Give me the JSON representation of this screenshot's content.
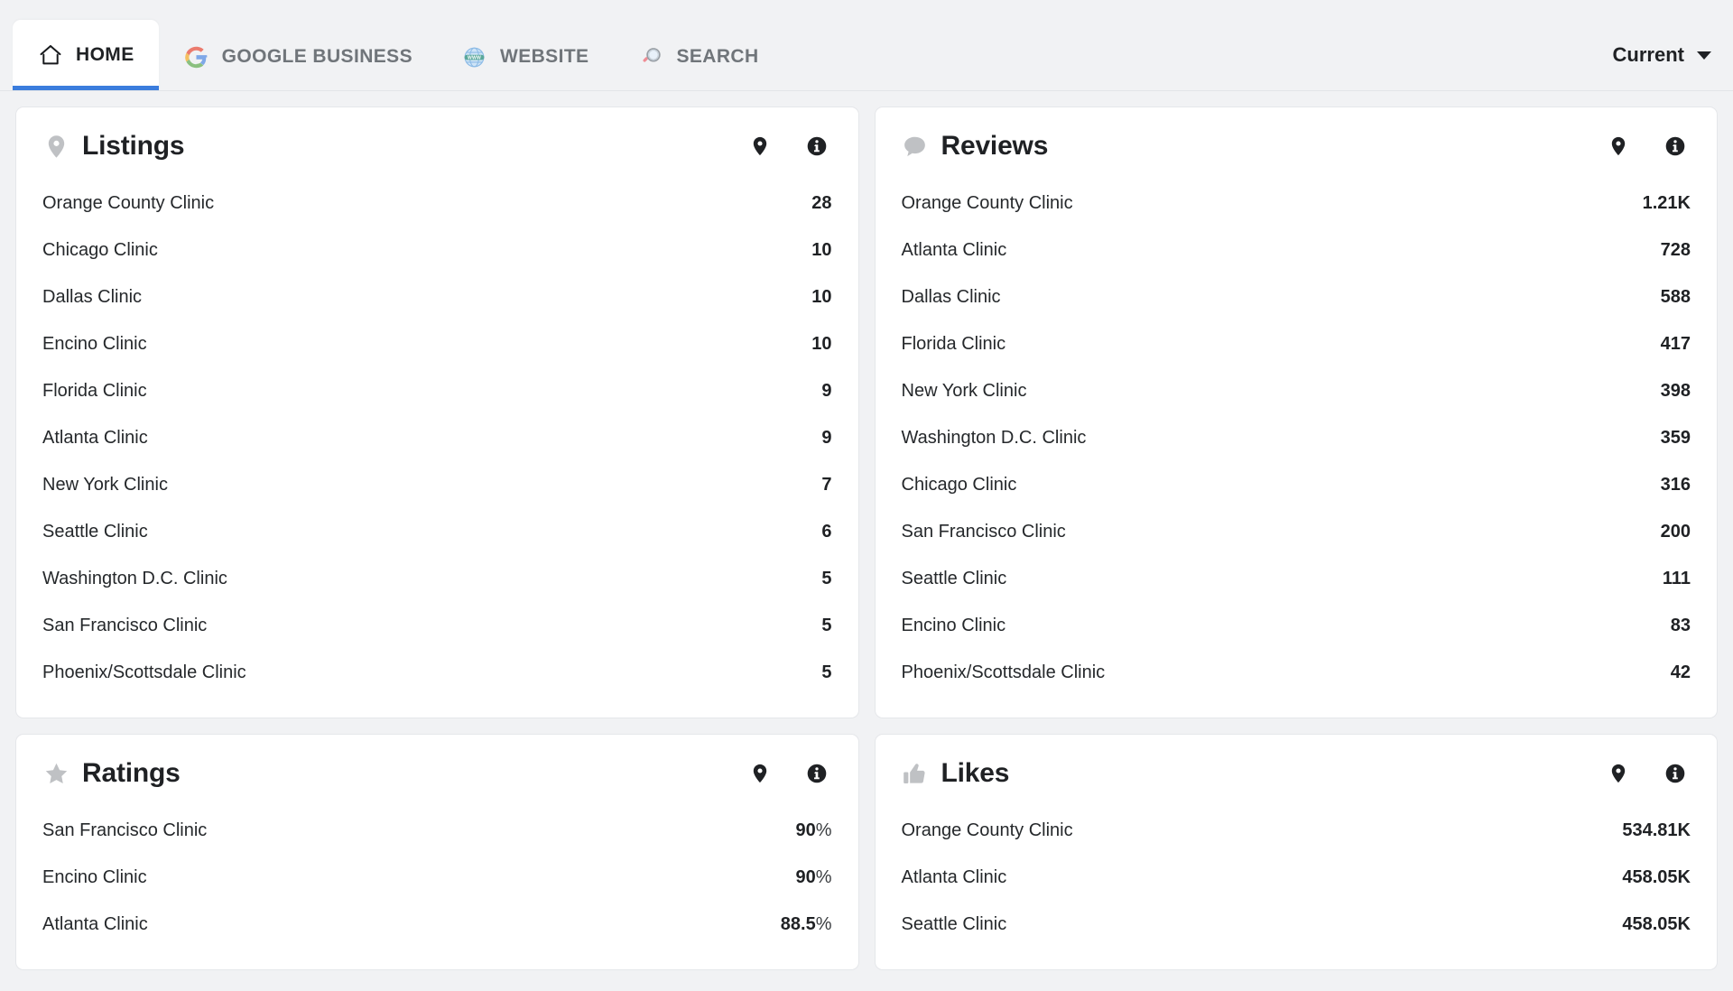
{
  "nav": {
    "tabs": [
      {
        "id": "home",
        "label": "HOME",
        "icon": "home-icon",
        "active": true
      },
      {
        "id": "google-business",
        "label": "GOOGLE BUSINESS",
        "icon": "google-logo-icon",
        "active": false
      },
      {
        "id": "website",
        "label": "WEBSITE",
        "icon": "www-globe-icon",
        "active": false
      },
      {
        "id": "search",
        "label": "SEARCH",
        "icon": "magnifier-icon",
        "active": false
      }
    ],
    "period_selector": {
      "label": "Current",
      "icon": "chevron-down-icon"
    },
    "active_tab_underline_color": "#3b7ddd"
  },
  "cards": [
    {
      "id": "listings",
      "title": "Listings",
      "title_icon": "map-pin-icon",
      "actions": [
        {
          "name": "map-view-icon",
          "icon": "map-pin-icon"
        },
        {
          "name": "info-icon",
          "icon": "info-circle-icon"
        }
      ],
      "rows": [
        {
          "name": "Orange County Clinic",
          "value": "28",
          "unit": ""
        },
        {
          "name": "Chicago Clinic",
          "value": "10",
          "unit": ""
        },
        {
          "name": "Dallas Clinic",
          "value": "10",
          "unit": ""
        },
        {
          "name": "Encino Clinic",
          "value": "10",
          "unit": ""
        },
        {
          "name": "Florida Clinic",
          "value": "9",
          "unit": ""
        },
        {
          "name": "Atlanta Clinic",
          "value": "9",
          "unit": ""
        },
        {
          "name": "New York Clinic",
          "value": "7",
          "unit": ""
        },
        {
          "name": "Seattle Clinic",
          "value": "6",
          "unit": ""
        },
        {
          "name": "Washington D.C. Clinic",
          "value": "5",
          "unit": ""
        },
        {
          "name": "San Francisco Clinic",
          "value": "5",
          "unit": ""
        },
        {
          "name": "Phoenix/Scottsdale Clinic",
          "value": "5",
          "unit": ""
        }
      ]
    },
    {
      "id": "reviews",
      "title": "Reviews",
      "title_icon": "speech-bubble-icon",
      "actions": [
        {
          "name": "map-view-icon",
          "icon": "map-pin-icon"
        },
        {
          "name": "info-icon",
          "icon": "info-circle-icon"
        }
      ],
      "rows": [
        {
          "name": "Orange County Clinic",
          "value": "1.21K",
          "unit": ""
        },
        {
          "name": "Atlanta Clinic",
          "value": "728",
          "unit": ""
        },
        {
          "name": "Dallas Clinic",
          "value": "588",
          "unit": ""
        },
        {
          "name": "Florida Clinic",
          "value": "417",
          "unit": ""
        },
        {
          "name": "New York Clinic",
          "value": "398",
          "unit": ""
        },
        {
          "name": "Washington D.C. Clinic",
          "value": "359",
          "unit": ""
        },
        {
          "name": "Chicago Clinic",
          "value": "316",
          "unit": ""
        },
        {
          "name": "San Francisco Clinic",
          "value": "200",
          "unit": ""
        },
        {
          "name": "Seattle Clinic",
          "value": "111",
          "unit": ""
        },
        {
          "name": "Encino Clinic",
          "value": "83",
          "unit": ""
        },
        {
          "name": "Phoenix/Scottsdale Clinic",
          "value": "42",
          "unit": ""
        }
      ]
    },
    {
      "id": "ratings",
      "title": "Ratings",
      "title_icon": "star-icon",
      "actions": [
        {
          "name": "map-view-icon",
          "icon": "map-pin-icon"
        },
        {
          "name": "info-icon",
          "icon": "info-circle-icon"
        }
      ],
      "rows": [
        {
          "name": "San Francisco Clinic",
          "value": "90",
          "unit": "%"
        },
        {
          "name": "Encino Clinic",
          "value": "90",
          "unit": "%"
        },
        {
          "name": "Atlanta Clinic",
          "value": "88.5",
          "unit": "%"
        }
      ]
    },
    {
      "id": "likes",
      "title": "Likes",
      "title_icon": "thumbs-up-icon",
      "actions": [
        {
          "name": "map-view-icon",
          "icon": "map-pin-icon"
        },
        {
          "name": "info-icon",
          "icon": "info-circle-icon"
        }
      ],
      "rows": [
        {
          "name": "Orange County Clinic",
          "value": "534.81K",
          "unit": ""
        },
        {
          "name": "Atlanta Clinic",
          "value": "458.05K",
          "unit": ""
        },
        {
          "name": "Seattle Clinic",
          "value": "458.05K",
          "unit": ""
        }
      ]
    }
  ],
  "colors": {
    "page_background": "#f1f2f4",
    "card_background": "#ffffff",
    "accent_blue": "#3b7ddd",
    "title_icon_gray": "#bfc1c4",
    "text_primary": "#1f2124",
    "text_muted": "#70757a"
  }
}
